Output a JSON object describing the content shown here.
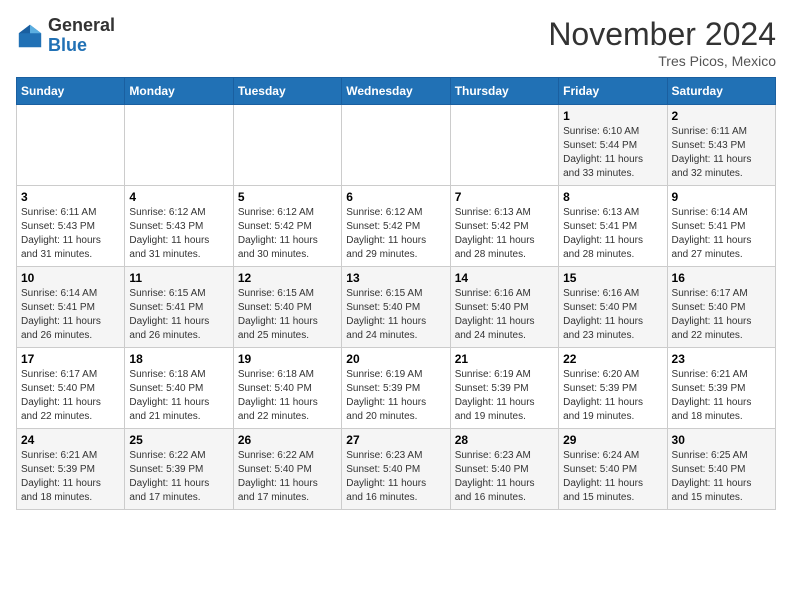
{
  "header": {
    "logo_general": "General",
    "logo_blue": "Blue",
    "month": "November 2024",
    "location": "Tres Picos, Mexico"
  },
  "days_of_week": [
    "Sunday",
    "Monday",
    "Tuesday",
    "Wednesday",
    "Thursday",
    "Friday",
    "Saturday"
  ],
  "weeks": [
    [
      {
        "day": "",
        "info": ""
      },
      {
        "day": "",
        "info": ""
      },
      {
        "day": "",
        "info": ""
      },
      {
        "day": "",
        "info": ""
      },
      {
        "day": "",
        "info": ""
      },
      {
        "day": "1",
        "info": "Sunrise: 6:10 AM\nSunset: 5:44 PM\nDaylight: 11 hours\nand 33 minutes."
      },
      {
        "day": "2",
        "info": "Sunrise: 6:11 AM\nSunset: 5:43 PM\nDaylight: 11 hours\nand 32 minutes."
      }
    ],
    [
      {
        "day": "3",
        "info": "Sunrise: 6:11 AM\nSunset: 5:43 PM\nDaylight: 11 hours\nand 31 minutes."
      },
      {
        "day": "4",
        "info": "Sunrise: 6:12 AM\nSunset: 5:43 PM\nDaylight: 11 hours\nand 31 minutes."
      },
      {
        "day": "5",
        "info": "Sunrise: 6:12 AM\nSunset: 5:42 PM\nDaylight: 11 hours\nand 30 minutes."
      },
      {
        "day": "6",
        "info": "Sunrise: 6:12 AM\nSunset: 5:42 PM\nDaylight: 11 hours\nand 29 minutes."
      },
      {
        "day": "7",
        "info": "Sunrise: 6:13 AM\nSunset: 5:42 PM\nDaylight: 11 hours\nand 28 minutes."
      },
      {
        "day": "8",
        "info": "Sunrise: 6:13 AM\nSunset: 5:41 PM\nDaylight: 11 hours\nand 28 minutes."
      },
      {
        "day": "9",
        "info": "Sunrise: 6:14 AM\nSunset: 5:41 PM\nDaylight: 11 hours\nand 27 minutes."
      }
    ],
    [
      {
        "day": "10",
        "info": "Sunrise: 6:14 AM\nSunset: 5:41 PM\nDaylight: 11 hours\nand 26 minutes."
      },
      {
        "day": "11",
        "info": "Sunrise: 6:15 AM\nSunset: 5:41 PM\nDaylight: 11 hours\nand 26 minutes."
      },
      {
        "day": "12",
        "info": "Sunrise: 6:15 AM\nSunset: 5:40 PM\nDaylight: 11 hours\nand 25 minutes."
      },
      {
        "day": "13",
        "info": "Sunrise: 6:15 AM\nSunset: 5:40 PM\nDaylight: 11 hours\nand 24 minutes."
      },
      {
        "day": "14",
        "info": "Sunrise: 6:16 AM\nSunset: 5:40 PM\nDaylight: 11 hours\nand 24 minutes."
      },
      {
        "day": "15",
        "info": "Sunrise: 6:16 AM\nSunset: 5:40 PM\nDaylight: 11 hours\nand 23 minutes."
      },
      {
        "day": "16",
        "info": "Sunrise: 6:17 AM\nSunset: 5:40 PM\nDaylight: 11 hours\nand 22 minutes."
      }
    ],
    [
      {
        "day": "17",
        "info": "Sunrise: 6:17 AM\nSunset: 5:40 PM\nDaylight: 11 hours\nand 22 minutes."
      },
      {
        "day": "18",
        "info": "Sunrise: 6:18 AM\nSunset: 5:40 PM\nDaylight: 11 hours\nand 21 minutes."
      },
      {
        "day": "19",
        "info": "Sunrise: 6:18 AM\nSunset: 5:40 PM\nDaylight: 11 hours\nand 22 minutes."
      },
      {
        "day": "20",
        "info": "Sunrise: 6:19 AM\nSunset: 5:39 PM\nDaylight: 11 hours\nand 20 minutes."
      },
      {
        "day": "21",
        "info": "Sunrise: 6:19 AM\nSunset: 5:39 PM\nDaylight: 11 hours\nand 19 minutes."
      },
      {
        "day": "22",
        "info": "Sunrise: 6:20 AM\nSunset: 5:39 PM\nDaylight: 11 hours\nand 19 minutes."
      },
      {
        "day": "23",
        "info": "Sunrise: 6:21 AM\nSunset: 5:39 PM\nDaylight: 11 hours\nand 18 minutes."
      }
    ],
    [
      {
        "day": "24",
        "info": "Sunrise: 6:21 AM\nSunset: 5:39 PM\nDaylight: 11 hours\nand 18 minutes."
      },
      {
        "day": "25",
        "info": "Sunrise: 6:22 AM\nSunset: 5:39 PM\nDaylight: 11 hours\nand 17 minutes."
      },
      {
        "day": "26",
        "info": "Sunrise: 6:22 AM\nSunset: 5:40 PM\nDaylight: 11 hours\nand 17 minutes."
      },
      {
        "day": "27",
        "info": "Sunrise: 6:23 AM\nSunset: 5:40 PM\nDaylight: 11 hours\nand 16 minutes."
      },
      {
        "day": "28",
        "info": "Sunrise: 6:23 AM\nSunset: 5:40 PM\nDaylight: 11 hours\nand 16 minutes."
      },
      {
        "day": "29",
        "info": "Sunrise: 6:24 AM\nSunset: 5:40 PM\nDaylight: 11 hours\nand 15 minutes."
      },
      {
        "day": "30",
        "info": "Sunrise: 6:25 AM\nSunset: 5:40 PM\nDaylight: 11 hours\nand 15 minutes."
      }
    ]
  ]
}
